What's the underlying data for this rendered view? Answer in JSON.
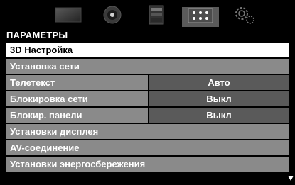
{
  "tabs": [
    {
      "icon": "picture-icon",
      "active": false
    },
    {
      "icon": "sound-icon",
      "active": false
    },
    {
      "icon": "channel-list-icon",
      "active": false
    },
    {
      "icon": "options-grid-icon",
      "active": true
    },
    {
      "icon": "settings-gears-icon",
      "active": false
    }
  ],
  "header": {
    "title": "ПАРАМЕТРЫ"
  },
  "menu": {
    "items": [
      {
        "label": "3D Настройка",
        "selected": true
      },
      {
        "label": "Установка сети"
      },
      {
        "label": "Телетекст",
        "value": "Авто"
      },
      {
        "label": "Блокировка сети",
        "value": "Выкл"
      },
      {
        "label": "Блокир. панели",
        "value": "Выкл"
      },
      {
        "label": "Установки дисплея"
      },
      {
        "label": "AV-соединение"
      },
      {
        "label": "Установки энергосбережения"
      }
    ]
  },
  "colors": {
    "background": "#000000",
    "row": "#8a8a8a",
    "value_cell": "#5a5a5a",
    "selected_row": "#ffffff",
    "text": "#ffffff"
  }
}
